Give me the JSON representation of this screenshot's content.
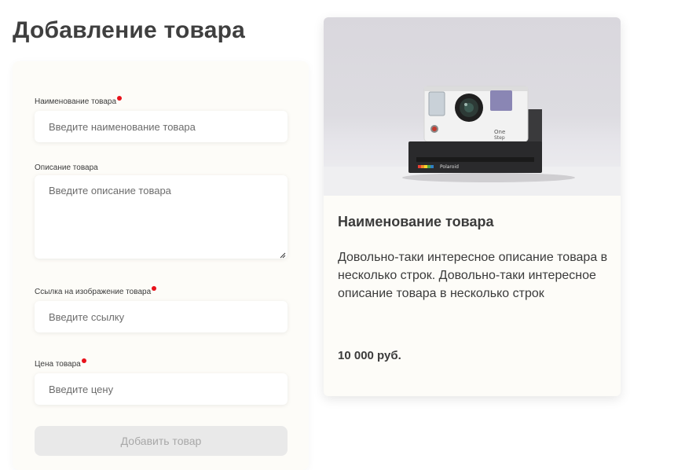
{
  "page": {
    "title": "Добавление товара"
  },
  "form": {
    "name": {
      "label": "Наименование товара",
      "placeholder": "Введите наименование товара",
      "required": true
    },
    "description": {
      "label": "Описание товара",
      "placeholder": "Введите описание товара",
      "required": false
    },
    "image_link": {
      "label": "Ссылка на изображение товара",
      "placeholder": "Введите ссылку",
      "required": true
    },
    "price": {
      "label": "Цена товара",
      "placeholder": "Введите цену",
      "required": true
    },
    "submit_label": "Добавить товар"
  },
  "preview": {
    "image_icon": "polaroid-camera-photo",
    "title": "Наименование товара",
    "description": "Довольно-таки интересное описание товара в несколько строк. Довольно-таки интересное описание товара в несколько строк",
    "price": "10 000 руб."
  },
  "colors": {
    "required_marker": "#e8121b",
    "card_background": "#fdfcf8",
    "button_disabled": "#e9e9e9"
  }
}
